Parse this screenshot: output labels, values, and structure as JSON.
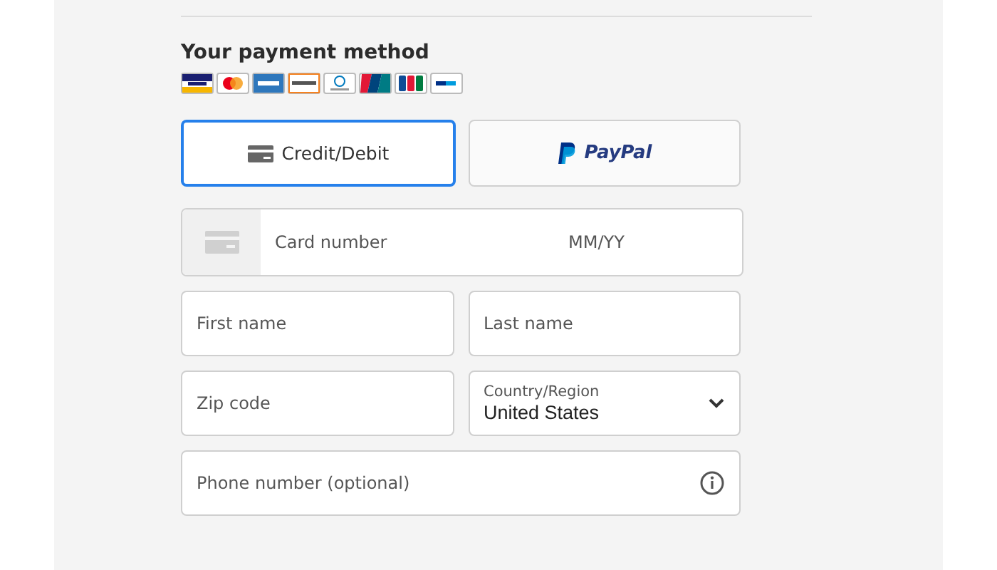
{
  "title": "Your payment method",
  "card_logos": [
    {
      "kind": "visa"
    },
    {
      "kind": "mastercard"
    },
    {
      "kind": "amex"
    },
    {
      "kind": "discover"
    },
    {
      "kind": "diners"
    },
    {
      "kind": "unionpay"
    },
    {
      "kind": "jcb"
    },
    {
      "kind": "paypal"
    }
  ],
  "methods": [
    {
      "kind": "card",
      "label": "Credit/Debit",
      "selected": true
    },
    {
      "kind": "paypal",
      "label": "PayPal",
      "selected": false
    }
  ],
  "card_field": {
    "placeholder": "Card number",
    "expiry_placeholder": "MM/YY"
  },
  "field_rows": [
    [
      {
        "kind": "text",
        "placeholder": "First name"
      },
      {
        "kind": "text",
        "placeholder": "Last name"
      }
    ],
    [
      {
        "kind": "text",
        "placeholder": "Zip code"
      },
      {
        "kind": "select",
        "label": "Country/Region",
        "value": "United States"
      }
    ],
    [
      {
        "kind": "info",
        "placeholder": "Phone number (optional)"
      }
    ]
  ]
}
